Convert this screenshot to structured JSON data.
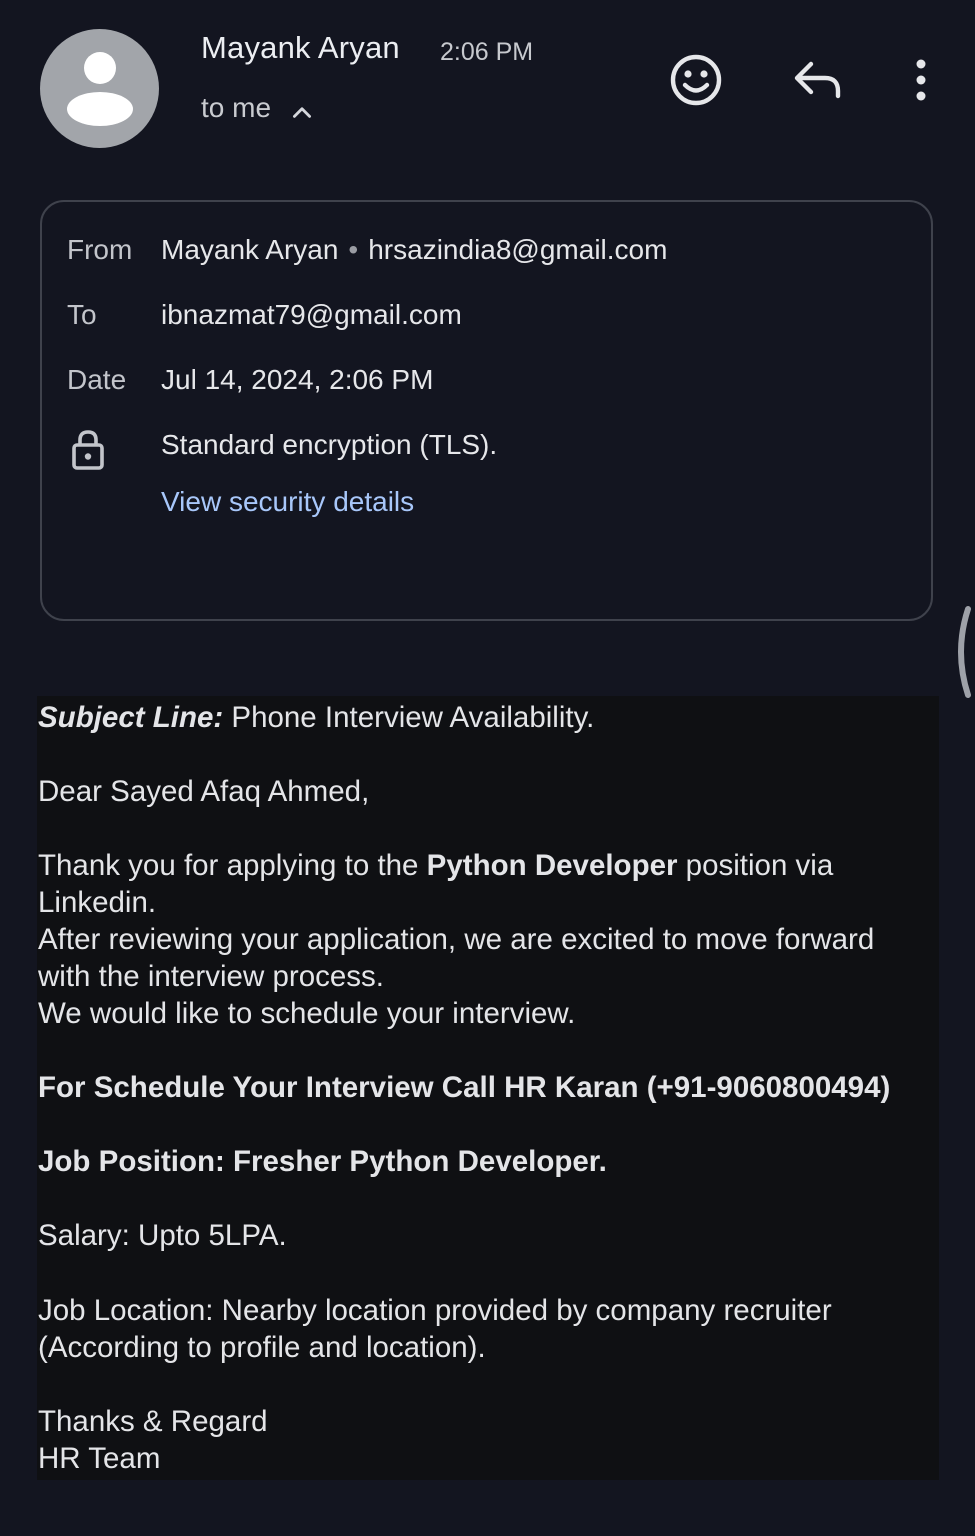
{
  "header": {
    "sender_name": "Mayank Aryan",
    "time": "2:06 PM",
    "recipient_summary": "to me"
  },
  "details": {
    "from_label": "From",
    "from_name": "Mayank Aryan",
    "from_separator": "•",
    "from_email": "hrsazindia8@gmail.com",
    "to_label": "To",
    "to_email": "ibnazmat79@gmail.com",
    "date_label": "Date",
    "date_value": "Jul 14, 2024, 2:06 PM",
    "encryption_text": "Standard encryption (TLS).",
    "security_link": "View security details"
  },
  "body": {
    "subject_label": "Subject Line:",
    "subject_text": " Phone Interview Availability.",
    "greeting": "Dear Sayed Afaq Ahmed,",
    "p1_pre": "Thank you for applying to the ",
    "p1_bold": "Python Developer",
    "p1_post": " position via",
    "p1_line2": "Linkedin.",
    "p2_line1": "After reviewing your application, we are excited to move forward",
    "p2_line2": "with the interview process.",
    "p3": "We would like to schedule your interview.",
    "schedule_line": "For Schedule Your Interview Call HR Karan (+91-9060800494)",
    "job_position": "Job Position: Fresher Python Developer.",
    "salary": "Salary: Upto 5LPA.",
    "location_line1": "Job Location: Nearby location provided by company recruiter",
    "location_line2": "(According to profile and location).",
    "signoff1": "Thanks & Regard",
    "signoff2": "HR Team"
  },
  "icons": {
    "avatar": "person-avatar-icon",
    "expand": "chevron-up-icon",
    "react": "emoji-smile-icon",
    "reply": "reply-arrow-icon",
    "more": "more-vertical-icon",
    "lock": "lock-icon"
  },
  "colors": {
    "background": "#131520",
    "link": "#a8c7fa",
    "card_border": "#3f424c",
    "body_background": "#0f1013"
  }
}
